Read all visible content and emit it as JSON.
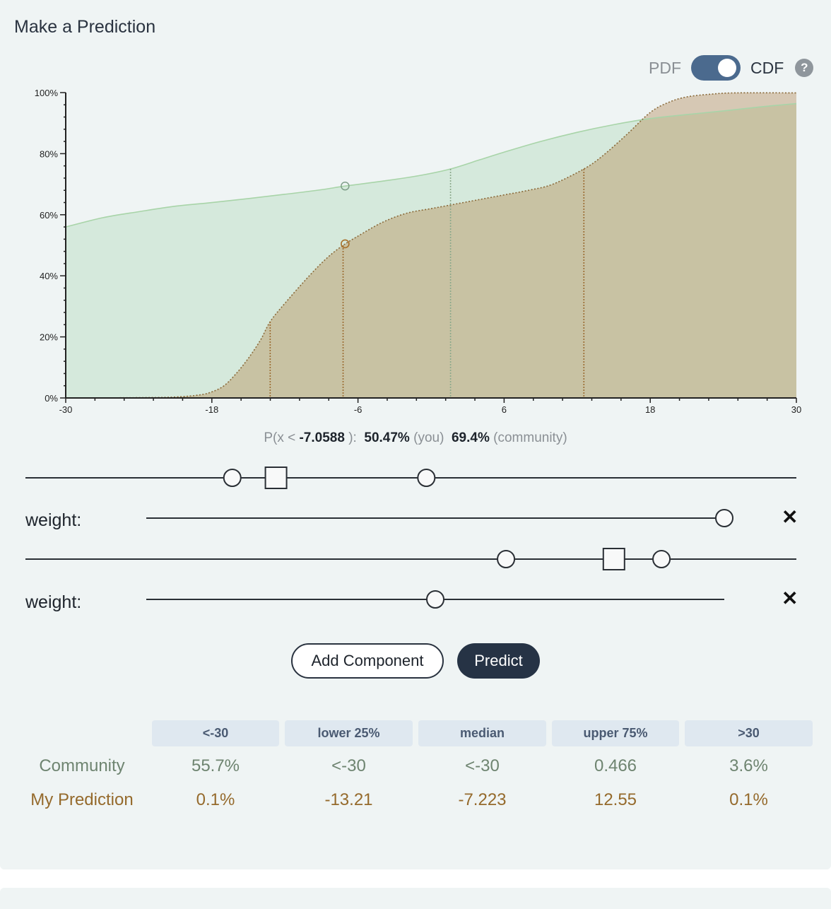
{
  "title": "Make a Prediction",
  "toggle": {
    "left_label": "PDF",
    "right_label": "CDF",
    "selected": "CDF",
    "help_glyph": "?"
  },
  "readout": {
    "prefix": "P(x < ",
    "x_value": "-7.0588",
    "suffix": " ):",
    "you_value": "50.47%",
    "you_label": "(you)",
    "community_value": "69.4%",
    "community_label": "(community)"
  },
  "components": [
    {
      "lower": -13.9,
      "center": -10.5,
      "upper": 1.2,
      "weight_fraction": 1.0,
      "weight_label": "weight:",
      "remove_glyph": "✕"
    },
    {
      "lower": 7.4,
      "center": 15.8,
      "upper": 19.5,
      "weight_fraction": 0.5,
      "weight_label": "weight:",
      "remove_glyph": "✕"
    }
  ],
  "slider_range": [
    -30,
    30
  ],
  "buttons": {
    "add_component": "Add Component",
    "predict": "Predict"
  },
  "table": {
    "headers": [
      "<-30",
      "lower 25%",
      "median",
      "upper 75%",
      ">30"
    ],
    "rows": [
      {
        "label": "Community",
        "values": [
          "55.7%",
          "<-30",
          "<-30",
          "0.466",
          "3.6%"
        ]
      },
      {
        "label": "My Prediction",
        "values": [
          "0.1%",
          "-13.21",
          "-7.223",
          "12.55",
          "0.1%"
        ]
      }
    ]
  },
  "colors": {
    "community_line": "#a8d4a8",
    "community_fill": "#d5e9dc",
    "mine_line": "#8a6a3a",
    "mine_fill": "#c8c2a3",
    "mine_fill_over": "#d6c8b4",
    "toggle": "#4b6a8e",
    "predict_button": "#263345"
  },
  "chart_data": {
    "type": "area",
    "title": "",
    "xlabel": "",
    "ylabel": "",
    "xlim": [
      -30,
      30
    ],
    "ylim": [
      0,
      100
    ],
    "x_ticks": [
      "-30",
      "-18",
      "-6",
      "6",
      "18",
      "30"
    ],
    "x_tick_values": [
      -30,
      -18,
      -6,
      6,
      18,
      30
    ],
    "y_ticks": [
      "0%",
      "20%",
      "40%",
      "60%",
      "80%",
      "100%"
    ],
    "y_tick_values": [
      0,
      20,
      40,
      60,
      80,
      100
    ],
    "grid": false,
    "series": [
      {
        "name": "community",
        "x": [
          -30,
          -27,
          -24,
          -21,
          -18,
          -15,
          -12,
          -9,
          -7.06,
          -4,
          -1,
          1.6,
          4,
          6,
          9,
          12,
          15,
          18,
          21,
          24,
          27,
          30
        ],
        "values": [
          56,
          59,
          61,
          62.8,
          64,
          65.3,
          66.7,
          68.2,
          69.4,
          71,
          72.8,
          75,
          78,
          80.5,
          84,
          87,
          89.5,
          91.5,
          92.8,
          94,
          95.3,
          96.4
        ]
      },
      {
        "name": "my prediction",
        "x": [
          -30,
          -24,
          -21,
          -19,
          -18,
          -17,
          -16,
          -15,
          -14,
          -13.21,
          -12,
          -10,
          -8.5,
          -7.223,
          -6,
          -4,
          -2,
          0,
          1.6,
          4,
          6,
          8,
          10,
          12.55,
          14,
          16,
          18,
          19.5,
          21,
          23,
          25,
          30
        ],
        "values": [
          0,
          0.1,
          0.3,
          1,
          2,
          4,
          8,
          13,
          19,
          25,
          31,
          40,
          46,
          50,
          53,
          57.5,
          60.5,
          62,
          63.2,
          65,
          66.5,
          68,
          70,
          75,
          79,
          86,
          93.5,
          96.8,
          98.6,
          99.5,
          99.9,
          99.9
        ]
      }
    ],
    "quartile_markers": {
      "community": [
        1.6
      ],
      "my_prediction": [
        -13.21,
        -7.223,
        12.55
      ]
    },
    "hover": {
      "x": -7.0588,
      "community": 69.4,
      "my_prediction": 50.47
    }
  }
}
